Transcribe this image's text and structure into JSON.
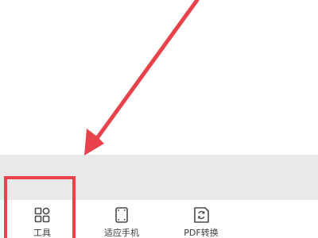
{
  "toolbar": {
    "items": [
      {
        "label": "工具",
        "icon": "grid-icon"
      },
      {
        "label": "适应手机",
        "icon": "phone-fit-icon"
      },
      {
        "label": "PDF转换",
        "icon": "pdf-convert-icon"
      }
    ]
  },
  "annotation": {
    "color": "#e8434b"
  },
  "colors": {
    "band": "#e9e9e9",
    "text": "#3a3a3a",
    "icon": "#4a4a4a"
  }
}
